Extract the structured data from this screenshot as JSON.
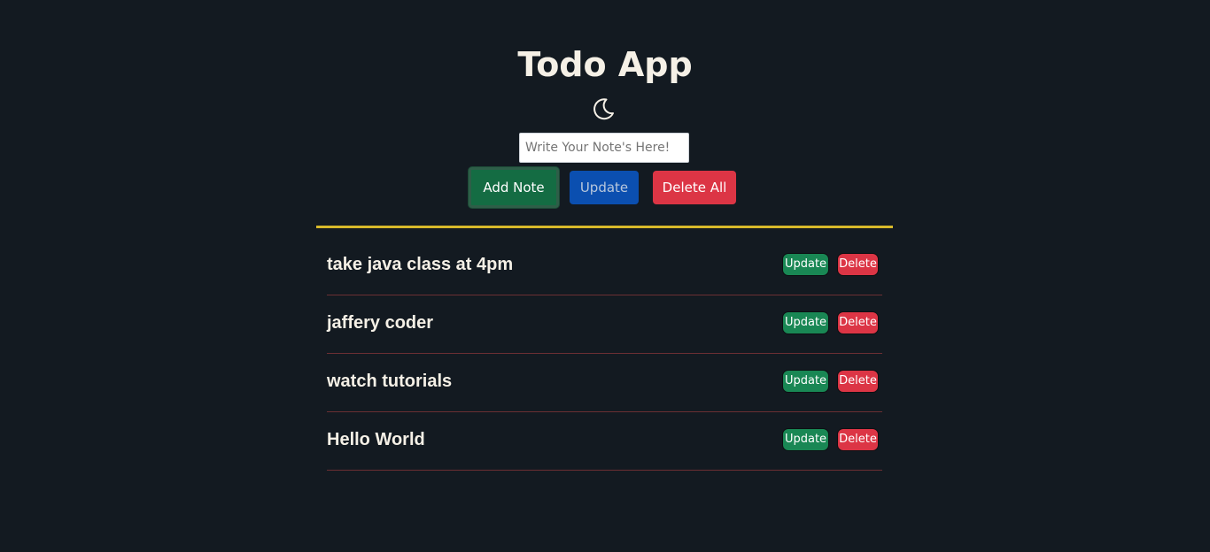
{
  "header": {
    "title": "Todo App",
    "theme_icon": "moon-icon"
  },
  "form": {
    "note_placeholder": "Write Your Note's Here!",
    "note_value": "",
    "add_label": "Add Note",
    "update_label": "Update",
    "delete_all_label": "Delete All"
  },
  "colors": {
    "background": "#131a21",
    "accent_divider": "#d7b92a",
    "success": "#198754",
    "primary": "#0b4fb0",
    "danger": "#dc3545"
  },
  "notes": [
    {
      "text": "take java class at 4pm",
      "update_label": "Update",
      "delete_label": "Delete"
    },
    {
      "text": "jaffery coder",
      "update_label": "Update",
      "delete_label": "Delete"
    },
    {
      "text": "watch tutorials",
      "update_label": "Update",
      "delete_label": "Delete"
    },
    {
      "text": "Hello World",
      "update_label": "Update",
      "delete_label": "Delete"
    }
  ]
}
